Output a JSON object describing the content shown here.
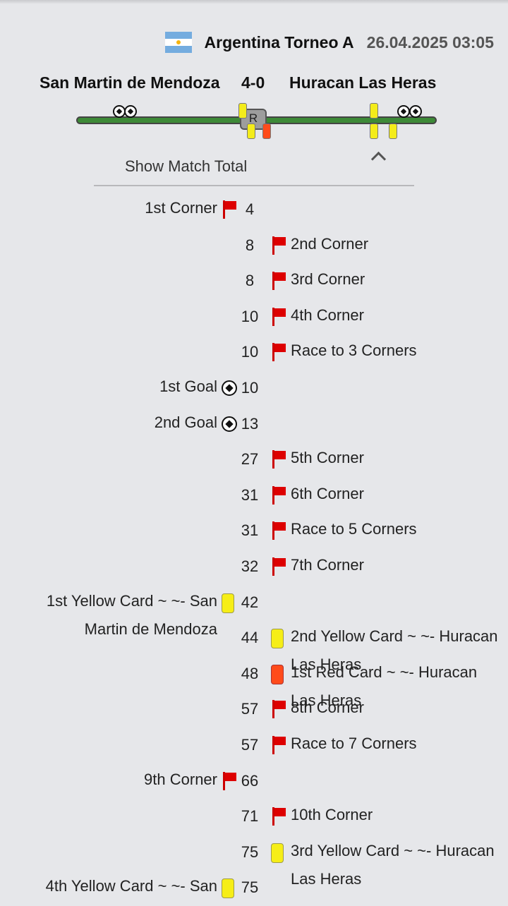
{
  "header": {
    "flag_icon": "argentina-flag",
    "league": "Argentina Torneo A",
    "datetime": "26.04.2025 03:05"
  },
  "match": {
    "home": "San Martin de Mendoza",
    "score": "4-0",
    "away": "Huracan Las Heras",
    "halftime_marker": "R"
  },
  "toggle": {
    "label": "Show Match Total",
    "icon": "chevron-up-icon"
  },
  "colors": {
    "yellow_card": "#f6ee17",
    "red_card": "#ff4b1a",
    "corner_flag": "#d00000",
    "timeline": "#3d8a37"
  },
  "events": [
    {
      "side": "home",
      "minute": "4",
      "label": "1st Corner",
      "icon": "corner-flag-icon"
    },
    {
      "side": "away",
      "minute": "8",
      "label": "2nd Corner",
      "icon": "corner-flag-icon"
    },
    {
      "side": "away",
      "minute": "8",
      "label": "3rd Corner",
      "icon": "corner-flag-icon"
    },
    {
      "side": "away",
      "minute": "10",
      "label": "4th Corner",
      "icon": "corner-flag-icon"
    },
    {
      "side": "away",
      "minute": "10",
      "label": "Race to 3 Corners",
      "icon": "corner-flag-icon"
    },
    {
      "side": "home",
      "minute": "10",
      "label": "1st Goal",
      "icon": "goal-ball-icon"
    },
    {
      "side": "home",
      "minute": "13",
      "label": "2nd Goal",
      "icon": "goal-ball-icon"
    },
    {
      "side": "away",
      "minute": "27",
      "label": "5th Corner",
      "icon": "corner-flag-icon"
    },
    {
      "side": "away",
      "minute": "31",
      "label": "6th Corner",
      "icon": "corner-flag-icon"
    },
    {
      "side": "away",
      "minute": "31",
      "label": "Race to 5 Corners",
      "icon": "corner-flag-icon"
    },
    {
      "side": "away",
      "minute": "32",
      "label": "7th Corner",
      "icon": "corner-flag-icon"
    },
    {
      "side": "home",
      "minute": "42",
      "label": "1st Yellow Card ~ ~- San Martin de Mendoza",
      "icon": "yellow-card-icon"
    },
    {
      "side": "away",
      "minute": "44",
      "label": "2nd Yellow Card ~ ~- Huracan Las Heras",
      "icon": "yellow-card-icon"
    },
    {
      "side": "away",
      "minute": "48",
      "label": "1st Red Card ~ ~- Huracan Las Heras",
      "icon": "red-card-icon"
    },
    {
      "side": "away",
      "minute": "57",
      "label": "8th Corner",
      "icon": "corner-flag-icon"
    },
    {
      "side": "away",
      "minute": "57",
      "label": "Race to 7 Corners",
      "icon": "corner-flag-icon"
    },
    {
      "side": "home",
      "minute": "66",
      "label": "9th Corner",
      "icon": "corner-flag-icon"
    },
    {
      "side": "away",
      "minute": "71",
      "label": "10th Corner",
      "icon": "corner-flag-icon"
    },
    {
      "side": "away",
      "minute": "75",
      "label": "3rd Yellow Card ~ ~- Huracan Las Heras",
      "icon": "yellow-card-icon"
    },
    {
      "side": "home",
      "minute": "75",
      "label": "4th Yellow Card ~ ~- San",
      "icon": "yellow-card-icon"
    }
  ]
}
